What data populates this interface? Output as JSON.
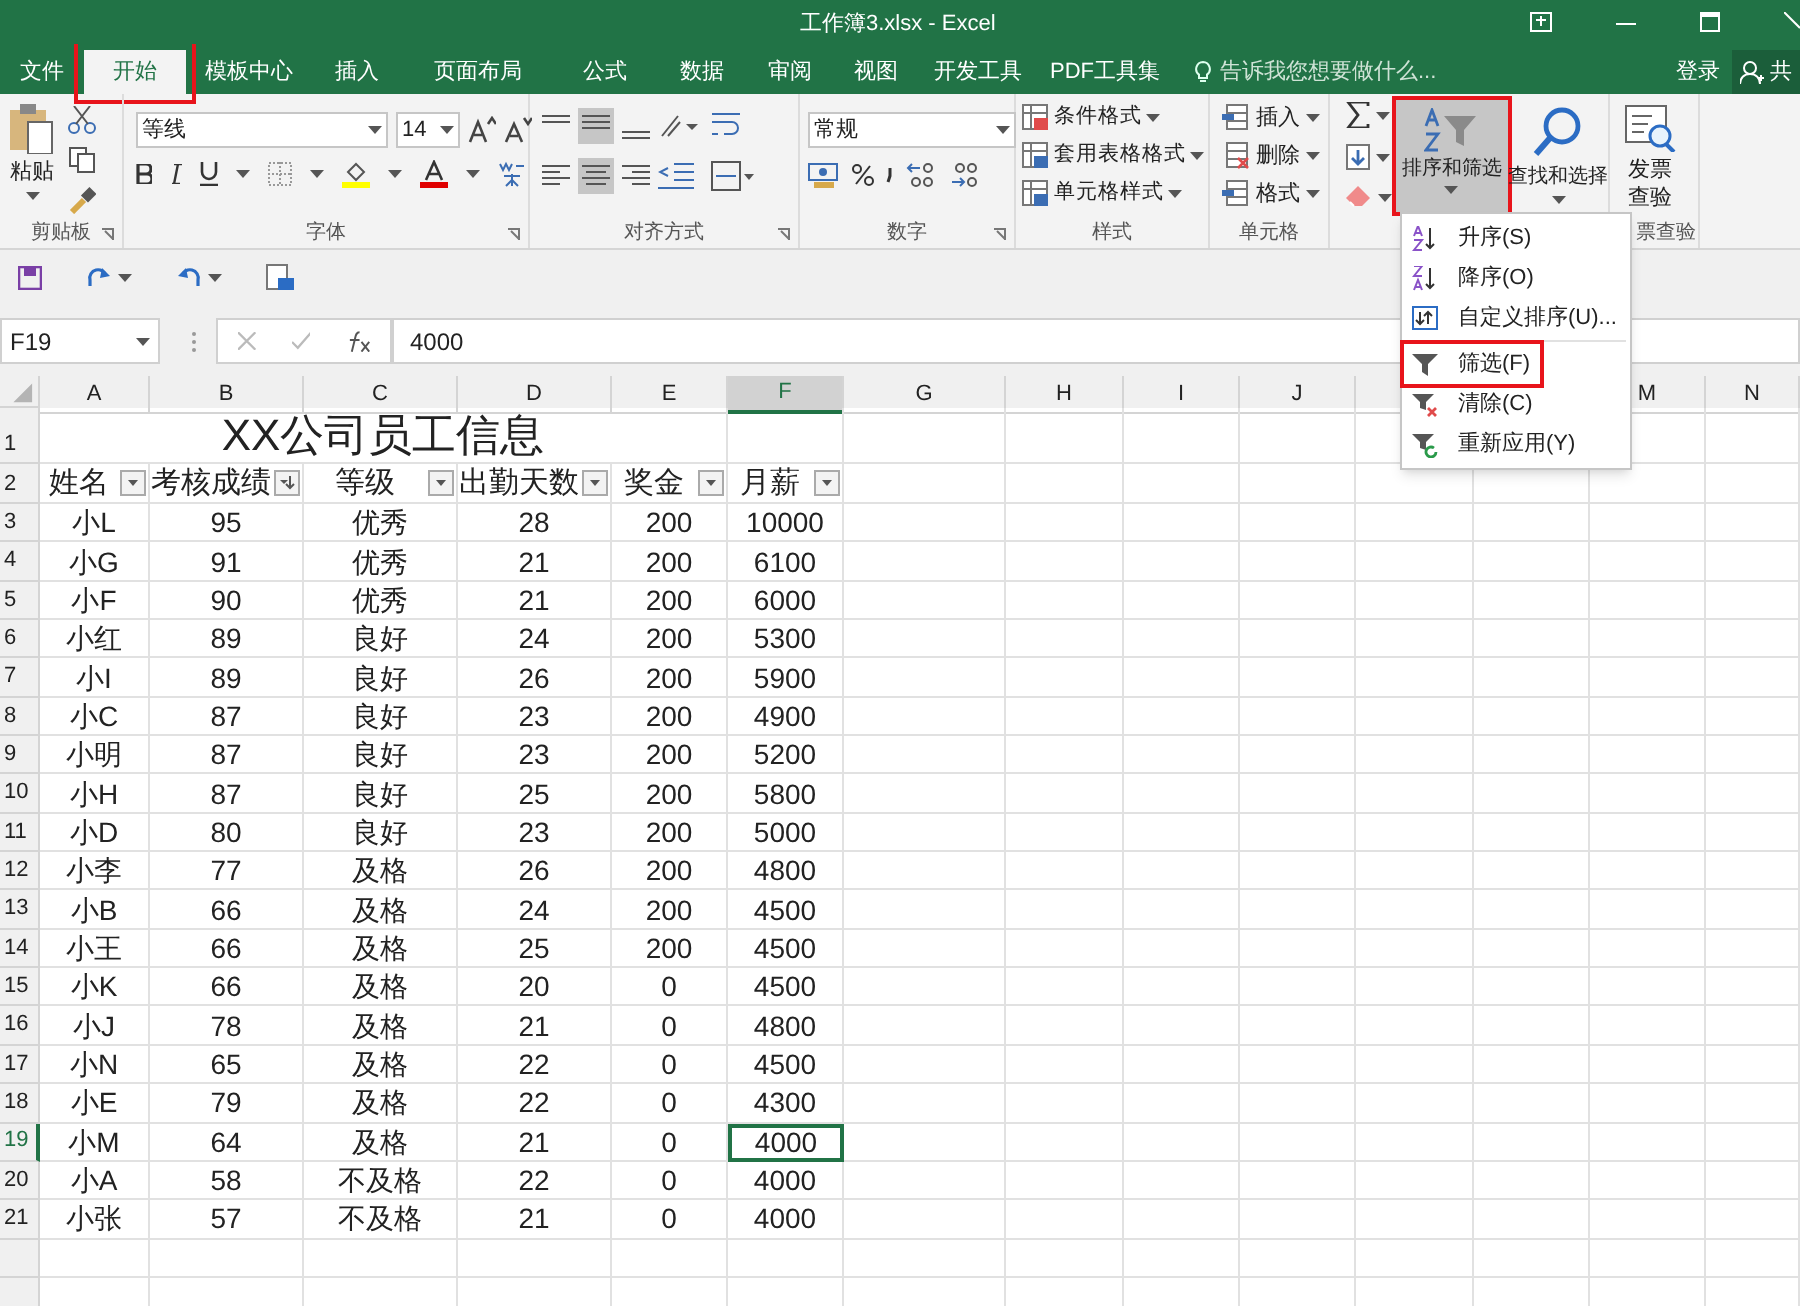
{
  "window": {
    "title": "工作簿3.xlsx - Excel"
  },
  "tabs": [
    {
      "label": "文件",
      "selected": false,
      "highlighted": false
    },
    {
      "label": "开始",
      "selected": true,
      "highlighted": true
    },
    {
      "label": "模板中心",
      "selected": false,
      "highlighted": false
    },
    {
      "label": "插入",
      "selected": false,
      "highlighted": false
    },
    {
      "label": "页面布局",
      "selected": false,
      "highlighted": false
    },
    {
      "label": "公式",
      "selected": false,
      "highlighted": false
    },
    {
      "label": "数据",
      "selected": false,
      "highlighted": false
    },
    {
      "label": "审阅",
      "selected": false,
      "highlighted": false
    },
    {
      "label": "视图",
      "selected": false,
      "highlighted": false
    },
    {
      "label": "开发工具",
      "selected": false,
      "highlighted": false
    },
    {
      "label": "PDF工具集",
      "selected": false,
      "highlighted": false
    }
  ],
  "tell_me": {
    "placeholder": "告诉我您想要做什么..."
  },
  "account": {
    "sign_in": "登录",
    "share": "共"
  },
  "ribbon": {
    "clipboard": {
      "paste": "粘贴",
      "label": "剪贴板"
    },
    "font": {
      "name": "等线",
      "size": "14",
      "label": "字体"
    },
    "alignment": {
      "label": "对齐方式"
    },
    "number": {
      "format": "常规",
      "label": "数字"
    },
    "styles": {
      "items": [
        "条件格式",
        "套用表格格式",
        "单元格样式"
      ],
      "label": "样式"
    },
    "cells": {
      "items": [
        "插入",
        "删除",
        "格式"
      ],
      "label": "单元格"
    },
    "editing": {
      "sort_filter": "排序和筛选",
      "sort_filter_pressed": true,
      "sort_filter_highlighted": true,
      "find": "查找和选择"
    },
    "invoice": {
      "button": "发票查验",
      "label": "票查验"
    }
  },
  "formula_bar": {
    "name_box": "F19",
    "value": "4000"
  },
  "sheet": {
    "columns": [
      {
        "label": "A",
        "selected": false
      },
      {
        "label": "B",
        "selected": false
      },
      {
        "label": "C",
        "selected": false
      },
      {
        "label": "D",
        "selected": false
      },
      {
        "label": "E",
        "selected": false
      },
      {
        "label": "F",
        "selected": true
      },
      {
        "label": "G",
        "selected": false
      },
      {
        "label": "H",
        "selected": false
      },
      {
        "label": "I",
        "selected": false
      },
      {
        "label": "J",
        "selected": false
      },
      {},
      {},
      {
        "label": "M",
        "selected": false
      },
      {
        "label": "N",
        "selected": false
      }
    ],
    "title_row": "1",
    "header_row": "2",
    "title": "XX公司员工信息",
    "headers": [
      {
        "label": "姓名",
        "kind": "filter"
      },
      {
        "label": "考核成绩",
        "kind": "sorted"
      },
      {
        "label": "等级",
        "kind": "filter"
      },
      {
        "label": "出勤天数",
        "kind": "filter"
      },
      {
        "label": "奖金",
        "kind": "filter"
      },
      {
        "label": "月薪",
        "kind": "filter"
      }
    ],
    "rows": [
      {
        "number": "3",
        "selected": false,
        "cells": [
          "小L",
          "95",
          "优秀",
          "28",
          "200",
          "10000"
        ]
      },
      {
        "number": "4",
        "selected": false,
        "cells": [
          "小G",
          "91",
          "优秀",
          "21",
          "200",
          "6100"
        ]
      },
      {
        "number": "5",
        "selected": false,
        "cells": [
          "小F",
          "90",
          "优秀",
          "21",
          "200",
          "6000"
        ]
      },
      {
        "number": "6",
        "selected": false,
        "cells": [
          "小红",
          "89",
          "良好",
          "24",
          "200",
          "5300"
        ]
      },
      {
        "number": "7",
        "selected": false,
        "cells": [
          "小I",
          "89",
          "良好",
          "26",
          "200",
          "5900"
        ]
      },
      {
        "number": "8",
        "selected": false,
        "cells": [
          "小C",
          "87",
          "良好",
          "23",
          "200",
          "4900"
        ]
      },
      {
        "number": "9",
        "selected": false,
        "cells": [
          "小明",
          "87",
          "良好",
          "23",
          "200",
          "5200"
        ]
      },
      {
        "number": "10",
        "selected": false,
        "cells": [
          "小H",
          "87",
          "良好",
          "25",
          "200",
          "5800"
        ]
      },
      {
        "number": "11",
        "selected": false,
        "cells": [
          "小D",
          "80",
          "良好",
          "23",
          "200",
          "5000"
        ]
      },
      {
        "number": "12",
        "selected": false,
        "cells": [
          "小李",
          "77",
          "及格",
          "26",
          "200",
          "4800"
        ]
      },
      {
        "number": "13",
        "selected": false,
        "cells": [
          "小B",
          "66",
          "及格",
          "24",
          "200",
          "4500"
        ]
      },
      {
        "number": "14",
        "selected": false,
        "cells": [
          "小王",
          "66",
          "及格",
          "25",
          "200",
          "4500"
        ]
      },
      {
        "number": "15",
        "selected": false,
        "cells": [
          "小K",
          "66",
          "及格",
          "20",
          "0",
          "4500"
        ]
      },
      {
        "number": "16",
        "selected": false,
        "cells": [
          "小J",
          "78",
          "及格",
          "21",
          "0",
          "4800"
        ]
      },
      {
        "number": "17",
        "selected": false,
        "cells": [
          "小N",
          "65",
          "及格",
          "22",
          "0",
          "4500"
        ]
      },
      {
        "number": "18",
        "selected": false,
        "cells": [
          "小E",
          "79",
          "及格",
          "22",
          "0",
          "4300"
        ]
      },
      {
        "number": "19",
        "selected": true,
        "cells": [
          "小M",
          "64",
          "及格",
          "21",
          "0",
          "4000"
        ]
      },
      {
        "number": "20",
        "selected": false,
        "cells": [
          "小A",
          "58",
          "不及格",
          "22",
          "0",
          "4000"
        ]
      },
      {
        "number": "21",
        "selected": false,
        "cells": [
          "小张",
          "57",
          "不及格",
          "21",
          "0",
          "4000"
        ]
      }
    ]
  },
  "sort_menu": [
    {
      "label": "升序(S)",
      "kind": "ascending",
      "highlighted": false
    },
    {
      "label": "降序(O)",
      "kind": "descending",
      "highlighted": false
    },
    {
      "label": "自定义排序(U)...",
      "kind": "custom",
      "highlighted": false
    },
    {
      "label": "筛选(F)",
      "kind": "filter",
      "highlighted": true
    },
    {
      "label": "清除(C)",
      "kind": "clear",
      "highlighted": false
    },
    {
      "label": "重新应用(Y)",
      "kind": "reapply",
      "highlighted": false
    }
  ]
}
